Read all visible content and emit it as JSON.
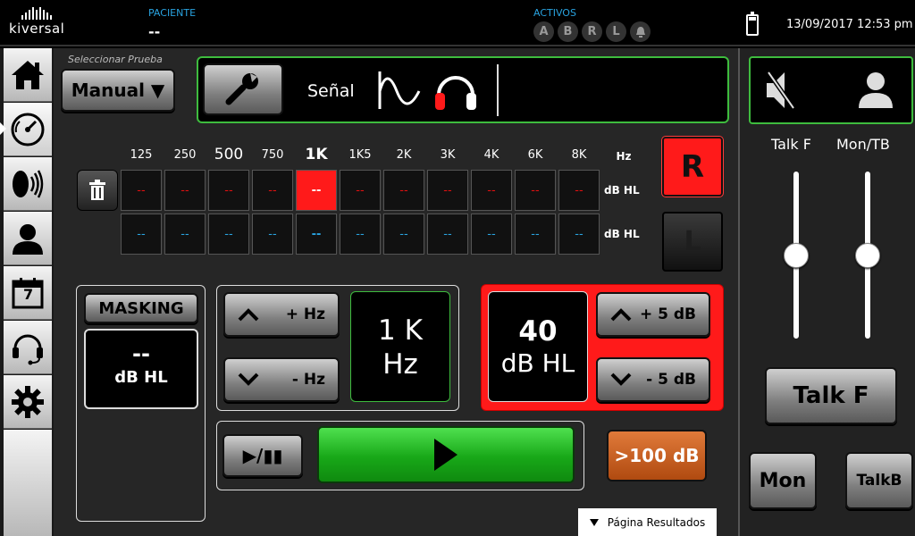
{
  "header": {
    "logo_text": "kiversal",
    "patient_label": "PACIENTE",
    "patient_value": "--",
    "active_label": "ACTIVOS",
    "active_items": [
      "A",
      "B",
      "R",
      "L"
    ],
    "datetime": "13/09/2017 12:53 pm"
  },
  "sidebar": {
    "items": [
      {
        "icon": "home-icon"
      },
      {
        "icon": "gauge-icon"
      },
      {
        "icon": "speaker-sound-icon"
      },
      {
        "icon": "user-icon"
      },
      {
        "icon": "calendar-icon",
        "text": "7"
      },
      {
        "icon": "headset-icon"
      },
      {
        "icon": "gear-icon"
      }
    ]
  },
  "test": {
    "select_label": "Seleccionar Prueba",
    "manual_label": "Manual ▼",
    "signal_label": "Señal"
  },
  "grid": {
    "frequencies": [
      "125",
      "250",
      "500",
      "750",
      "1K",
      "1K5",
      "2K",
      "3K",
      "4K",
      "6K",
      "8K"
    ],
    "unit": "Hz",
    "row_unit": "dB HL",
    "right_values": [
      "--",
      "--",
      "--",
      "--",
      "--",
      "--",
      "--",
      "--",
      "--",
      "--",
      "--"
    ],
    "left_values": [
      "--",
      "--",
      "--",
      "--",
      "--",
      "--",
      "--",
      "--",
      "--",
      "--",
      "--"
    ],
    "right_button": "R",
    "left_button": "L"
  },
  "masking": {
    "label": "MASKING",
    "value": "--",
    "unit": "dB HL"
  },
  "frequency_control": {
    "up_label": "+ Hz",
    "down_label": "- Hz",
    "value": "1 K",
    "unit": "Hz"
  },
  "intensity": {
    "value": "40",
    "unit": "dB HL",
    "up_label": "+ 5 dB",
    "down_label": "- 5 dB",
    "over_label": ">100 dB"
  },
  "playback": {
    "pause_label": "▶/▮▮"
  },
  "results": {
    "label": "Página Resultados"
  },
  "right_panel": {
    "talk_f_label": "Talk F",
    "mon_tb_label": "Mon/TB",
    "talk_f_level": 0.5,
    "mon_tb_level": 0.5,
    "talk_f_button": "Talk F",
    "mon_button": "Mon",
    "talkb_button": "TalkB"
  },
  "colors": {
    "accent_green": "#3ebc3e",
    "accent_red": "#ff1a1a",
    "label_blue": "#29a3e0",
    "over_orange": "#c8581a"
  }
}
